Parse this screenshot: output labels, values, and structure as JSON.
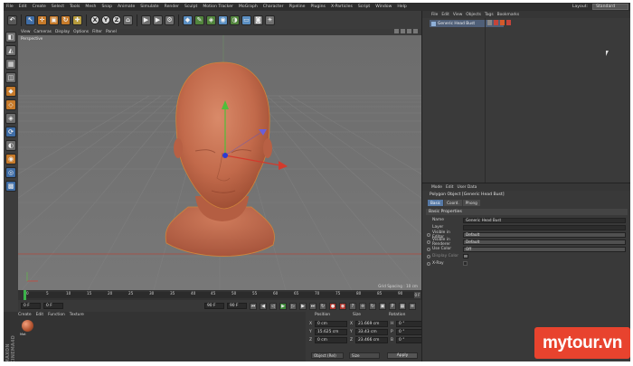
{
  "menubar": {
    "items": [
      "File",
      "Edit",
      "Create",
      "Select",
      "Tools",
      "Mesh",
      "Snap",
      "Animate",
      "Simulate",
      "Render",
      "Sculpt",
      "Motion Tracker",
      "MoGraph",
      "Character",
      "Pipeline",
      "Plugins",
      "X-Particles",
      "Script",
      "Window",
      "Help"
    ],
    "layout_label": "Layout:",
    "layout_value": "Standard"
  },
  "toolbar": {
    "axis_x": "X",
    "axis_y": "Y",
    "axis_z": "Z"
  },
  "viewport": {
    "menu": [
      "View",
      "Cameras",
      "Display",
      "Options",
      "Filter",
      "Panel"
    ],
    "label": "Perspective",
    "grid_spacing": "Grid Spacing : 10 cm"
  },
  "timeline": {
    "ticks": [
      "0",
      "5",
      "10",
      "15",
      "20",
      "25",
      "30",
      "35",
      "40",
      "45",
      "50",
      "55",
      "60",
      "65",
      "70",
      "75",
      "80",
      "85",
      "90"
    ],
    "end_label": "0 F"
  },
  "transport": {
    "start_field": "0 F",
    "mid_field": "0 F",
    "end_field": "90 F",
    "end_field2": "90 F"
  },
  "material_manager": {
    "menu": [
      "Create",
      "Edit",
      "Function",
      "Texture"
    ],
    "material_name": "Mat",
    "brand": "MAXON CINEMA4D"
  },
  "coordinates": {
    "headers": [
      "Position",
      "Size",
      "Rotation"
    ],
    "rows": [
      {
        "axis": "X",
        "pos": "0 cm",
        "size_axis": "X",
        "size": "21.669 cm",
        "rot_axis": "H",
        "rot": "0 °"
      },
      {
        "axis": "Y",
        "pos": "15.625 cm",
        "size_axis": "Y",
        "size": "33.43 cm",
        "rot_axis": "P",
        "rot": "0 °"
      },
      {
        "axis": "Z",
        "pos": "0 cm",
        "size_axis": "Z",
        "size": "23.466 cm",
        "rot_axis": "B",
        "rot": "0 °"
      }
    ],
    "mode": "Object (Rel)",
    "size_mode": "Size",
    "apply": "Apply"
  },
  "object_manager": {
    "menu": [
      "File",
      "Edit",
      "View",
      "Objects",
      "Tags",
      "Bookmarks"
    ],
    "object_name": "Generic Head Bust"
  },
  "attributes": {
    "menu": [
      "Mode",
      "Edit",
      "User Data"
    ],
    "title": "Polygon Object [Generic Head Bust]",
    "tabs": [
      "Basic",
      "Coord.",
      "Phong"
    ],
    "section": "Basic Properties",
    "rows": [
      {
        "label": "Name",
        "value": "Generic Head Bust"
      },
      {
        "label": "Layer",
        "value": ""
      },
      {
        "label": "Visible in Editor",
        "value": "Default"
      },
      {
        "label": "Visible in Renderer",
        "value": "Default"
      },
      {
        "label": "Use Color",
        "value": "Off"
      },
      {
        "label": "Display Color",
        "value": ""
      },
      {
        "label": "X-Ray",
        "value": ""
      }
    ]
  },
  "watermark": {
    "text": "mytour.vn"
  },
  "colors": {
    "accent": "#5679a6",
    "head_skin": "#c26a4b",
    "watermark": "#e8432e"
  }
}
